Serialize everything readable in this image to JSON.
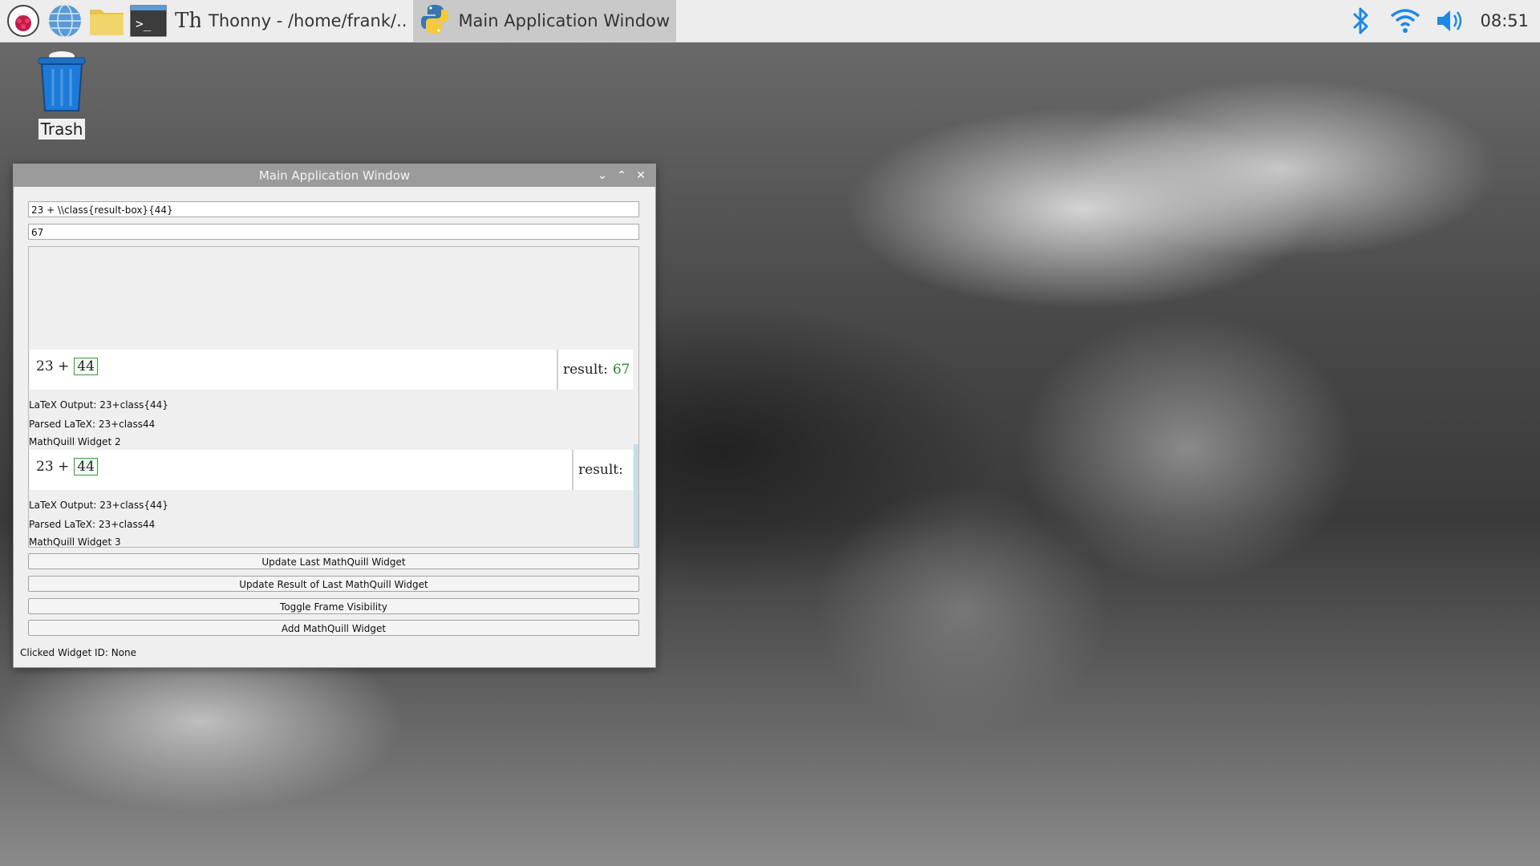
{
  "taskbar": {
    "tasks": [
      {
        "label": "Thonny  -  /home/frank/.."
      },
      {
        "label": "Main Application Window"
      }
    ],
    "clock": "08:51"
  },
  "desktop": {
    "trash_label": "Trash"
  },
  "window": {
    "title": "Main Application Window",
    "latex_input": "23 + \\\\class{result-box}{44}",
    "result_input": "67",
    "widgets": [
      {
        "expr_left": "23 +",
        "expr_box": "44",
        "result_label": "result:",
        "result_value": "67",
        "latex_output": "LaTeX Output: 23+class{44}",
        "parsed_latex": "Parsed LaTeX: 23+class44",
        "caption_next": "MathQuill Widget 2"
      },
      {
        "expr_left": "23 +",
        "expr_box": "44",
        "result_label": "result:",
        "result_value": "",
        "latex_output": "LaTeX Output: 23+class{44}",
        "parsed_latex": "Parsed LaTeX: 23+class44",
        "caption_next": "MathQuill Widget 3"
      }
    ],
    "buttons": {
      "update_last": "Update Last MathQuill Widget",
      "update_result": "Update Result of Last MathQuill Widget",
      "toggle_frame": "Toggle Frame Visibility",
      "add_widget": "Add MathQuill Widget"
    },
    "status": "Clicked Widget ID: None"
  },
  "colors": {
    "result_value": "#2a8a2a",
    "mq_box_border": "#3a9a3a",
    "accent_blue": "#1e88e5"
  }
}
